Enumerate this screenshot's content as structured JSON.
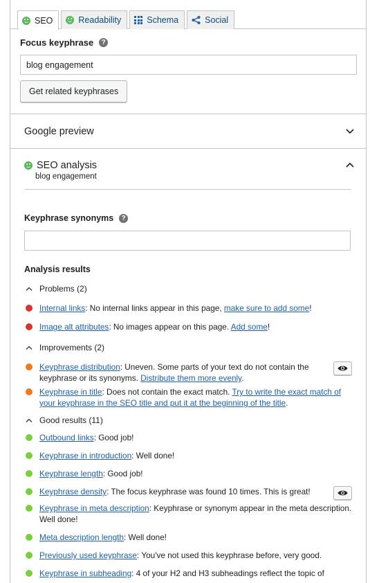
{
  "tabs": [
    {
      "label": "SEO",
      "icon": "smiley-icon"
    },
    {
      "label": "Readability",
      "icon": "smiley-icon"
    },
    {
      "label": "Schema",
      "icon": "grid-icon"
    },
    {
      "label": "Social",
      "icon": "share-icon"
    }
  ],
  "focus": {
    "label": "Focus keyphrase",
    "value": "blog engagement",
    "button": "Get related keyphrases"
  },
  "google_preview": {
    "label": "Google preview"
  },
  "seo_analysis": {
    "title": "SEO analysis",
    "subtitle": "blog engagement"
  },
  "synonyms": {
    "label": "Keyphrase synonyms",
    "value": ""
  },
  "analysis": {
    "title": "Analysis results",
    "problems": {
      "label": "Problems (2)",
      "items": [
        {
          "link": "Internal links",
          "text": ": No internal links appear in this page, ",
          "link2": "make sure to add some",
          "tail": "!"
        },
        {
          "link": "Image alt attributes",
          "text": ": No images appear on this page. ",
          "link2": "Add some",
          "tail": "!"
        }
      ]
    },
    "improvements": {
      "label": "Improvements (2)",
      "items": [
        {
          "link": "Keyphrase distribution",
          "text": ": Uneven. Some parts of your text do not contain the keyphrase or its synonyms. ",
          "link2": "Distribute them more evenly",
          "tail": "."
        },
        {
          "link": "Keyphrase in title",
          "text": ": Does not contain the exact match. ",
          "link2": "Try to write the exact match of your keyphrase in the SEO title and put it at the beginning of the title",
          "tail": "."
        }
      ]
    },
    "good": {
      "label": "Good results (11)",
      "items": [
        {
          "link": "Outbound links",
          "text": ": Good job!"
        },
        {
          "link": "Keyphrase in introduction",
          "text": ": Well done!"
        },
        {
          "link": "Keyphrase length",
          "text": ": Good job!"
        },
        {
          "link": "Keyphrase density",
          "text": ": The focus keyphrase was found 10 times. This is great!"
        },
        {
          "link": "Keyphrase in meta description",
          "text": ": Keyphrase or synonym appear in the meta description. Well done!"
        },
        {
          "link": "Meta description length",
          "text": ": Well done!"
        },
        {
          "link": "Previously used keyphrase",
          "text": ": You've not used this keyphrase before, very good."
        },
        {
          "link": "Keyphrase in subheading",
          "text": ": 4 of your H2 and H3 subheadings reflect the topic of"
        }
      ]
    }
  },
  "colors": {
    "problem": "#dc3232",
    "improvement": "#ee7c1b",
    "good": "#7ad03a",
    "link": "#1d5fa8"
  }
}
